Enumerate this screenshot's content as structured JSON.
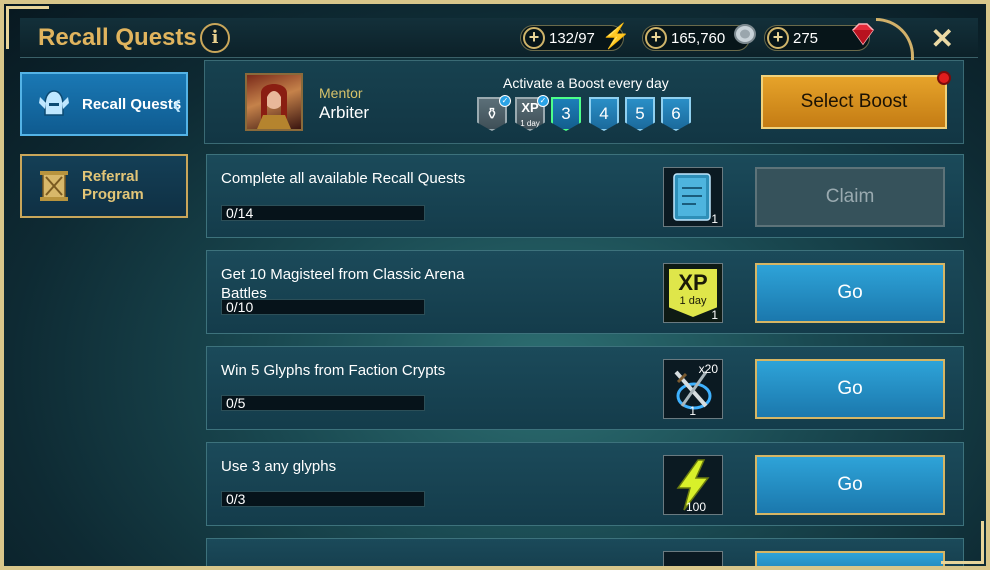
{
  "header": {
    "title": "Recall Quests",
    "info_label": "i",
    "resources": [
      {
        "value": "132/97",
        "icon": "lightning-energy-icon"
      },
      {
        "value": "165,760",
        "icon": "silver-coin-icon"
      },
      {
        "value": "275",
        "icon": "ruby-gem-icon"
      }
    ],
    "close_label": "✕"
  },
  "sidebar": {
    "items": [
      {
        "label": "Recall Quests",
        "active": true,
        "icon": "helmet-wings-icon"
      },
      {
        "label": "Referral Program",
        "active": false,
        "icon": "scroll-banner-icon"
      }
    ]
  },
  "mentor": {
    "caption": "Mentor",
    "name": "Arbiter",
    "boost_caption": "Activate a Boost every day",
    "boost_days": [
      "",
      "XP",
      "3",
      "4",
      "5",
      "6"
    ],
    "boost_day1_icon": "potion-icon",
    "boost_day2_sub": "1 day",
    "select_boost_label": "Select Boost"
  },
  "quests": [
    {
      "title": "Complete all available Recall Quests",
      "progress": "0/14",
      "reward_icon": "blue-tome-icon",
      "reward_qty": "1",
      "button": "Claim",
      "button_state": "disabled"
    },
    {
      "title": "Get 10 Magisteel from Classic Arena Battles",
      "progress": "0/10",
      "reward_icon": "xp-boost-icon",
      "reward_main": "XP",
      "reward_sub": "1 day",
      "reward_qty": "1",
      "button": "Go",
      "button_state": "active"
    },
    {
      "title": "Win 5 Glyphs from Faction Crypts",
      "progress": "0/5",
      "reward_icon": "sword-glyph-icon",
      "reward_extra": "x20",
      "reward_qty": "1",
      "button": "Go",
      "button_state": "active"
    },
    {
      "title": "Use 3 any glyphs",
      "progress": "0/3",
      "reward_icon": "lightning-energy-icon",
      "reward_qty": "100",
      "button": "Go",
      "button_state": "active"
    }
  ]
}
